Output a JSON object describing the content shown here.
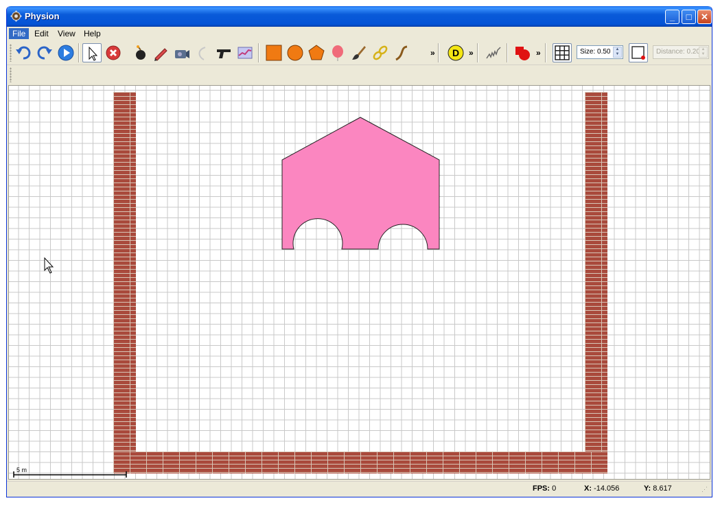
{
  "window": {
    "title": "Physion"
  },
  "menu": {
    "items": [
      "File",
      "Edit",
      "View",
      "Help"
    ],
    "active_index": 0
  },
  "toolbar": {
    "more_glyph": "»",
    "size_label": "Size:",
    "size_value": "0.50",
    "distance_label": "Distance:",
    "distance_value": "0.20"
  },
  "canvas": {
    "scale_label": "5 m",
    "colors": {
      "polygon_fill": "#fb86c0",
      "brick": "#a94a3c",
      "grid": "#c8c8c8"
    }
  },
  "status": {
    "fps_label": "FPS:",
    "fps_value": "0",
    "x_label": "X:",
    "x_value": "-14.056",
    "y_label": "Y:",
    "y_value": "8.617"
  }
}
